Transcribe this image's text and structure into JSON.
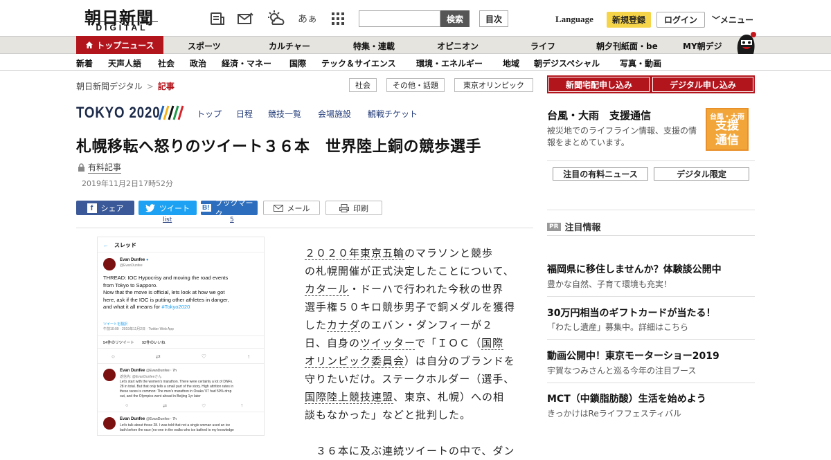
{
  "header": {
    "logo_main": "朝日新聞",
    "logo_sub": "DIGITAL",
    "font_icon_label": "あぁ",
    "search_placeholder": "",
    "search_button": "検索",
    "index_button": "目次",
    "language": "Language",
    "register": "新規登録",
    "login": "ログイン",
    "menu": "メニュー"
  },
  "nav1": {
    "active": "トップニュース",
    "items": [
      "スポーツ",
      "カルチャー",
      "特集・連載",
      "オピニオン",
      "ライフ",
      "朝夕刊紙面・be",
      "MY朝デジ"
    ]
  },
  "nav2": {
    "items": [
      "新着",
      "天声人語",
      "社会",
      "政治",
      "経済・マネー",
      "国際",
      "テック＆サイエンス",
      "環境・エネルギー",
      "地域",
      "朝デジスペシャル",
      "写真・動画"
    ]
  },
  "breadcrumb": {
    "home": "朝日新聞デジタル",
    "sep": ">",
    "current": "記事"
  },
  "tags": [
    "社会",
    "その他・話題",
    "東京オリンピック"
  ],
  "tokyo": {
    "logo": "TOKYO 2020",
    "nav": [
      "トップ",
      "日程",
      "競技一覧",
      "会場施設",
      "観戦チケット"
    ]
  },
  "article": {
    "headline": "札幌移転へ怒りのツイート３６本　世界陸上銅の競歩選手",
    "paid_label": "有料記事",
    "date": "2019年11月2日17時52分",
    "body_lines": [
      [
        {
          "t": "２０２０年東京五輪",
          "l": true
        },
        {
          "t": "のマラソンと競歩",
          "l": false
        }
      ],
      [
        {
          "t": "の札幌開催が正式決定したことについて、",
          "l": false
        }
      ],
      [
        {
          "t": "カタール",
          "l": true
        },
        {
          "t": "・ドーハで行われた今秋の世界",
          "l": false
        }
      ],
      [
        {
          "t": "選手権５０キロ競歩男子で銅メダルを獲得",
          "l": false
        }
      ],
      [
        {
          "t": "した",
          "l": false
        },
        {
          "t": "カナダ",
          "l": true
        },
        {
          "t": "のエバン・ダンフィーが２",
          "l": false
        }
      ],
      [
        {
          "t": "日、自身の",
          "l": false
        },
        {
          "t": "ツイッター",
          "l": true
        },
        {
          "t": "で「ＩＯＣ（",
          "l": false
        },
        {
          "t": "国際",
          "l": true
        }
      ],
      [
        {
          "t": "オリンピック委員会",
          "l": true
        },
        {
          "t": "）は自分のブランドを",
          "l": false
        }
      ],
      [
        {
          "t": "守りたいだけ。ステークホルダー（選手、",
          "l": false
        }
      ],
      [
        {
          "t": "国際陸上競技連盟",
          "l": true
        },
        {
          "t": "、東京、札幌）への相",
          "l": false
        }
      ],
      [
        {
          "t": "談もなかった」などと批判した。",
          "l": false
        }
      ],
      [
        {
          "t": "",
          "l": false
        }
      ],
      [
        {
          "t": "　３６本に及ぶ連続ツイートの中で、ダン",
          "l": false
        }
      ]
    ]
  },
  "share": {
    "facebook": "シェア",
    "twitter": "ツイート",
    "twitter_count": "list",
    "hatena": "ブックマーク",
    "hatena_count": "5",
    "mail": "メール",
    "print": "印刷"
  },
  "tweet": {
    "header": "スレッド",
    "name": "Evan Dunfee",
    "handle": "@EvanDunfee",
    "body": [
      "THREAD: IOC Hypocrisy and moving the road events",
      "from Tokyo to Sapporo.",
      "Now that the move is official, lets look at how we got",
      "here, ask if the IOC is putting other athletes in danger,",
      "and what it all means for "
    ],
    "hashtag": "#Tokyo2020",
    "translate": "ツイートを翻訳",
    "meta": "午前10:09 · 2019年11月2日 · Twitter Web App",
    "retweets": "54件のリツイート",
    "likes": "92件のいいね",
    "reply1_name": "Evan Dunfee",
    "reply1_handle": "@EvanDunfee · 7h",
    "reply1_to": "返信先: @EvanDunfeeさん",
    "reply1_body": [
      "Let's start with the women's marathon. There were certainly a lot of DNFs.",
      "28 in total. But that only tells a small part of the story. High attrition rates in",
      "these races is common: The men's marathon in Osaka '07 had 50% drop",
      "out, and the Olympics went ahead in Beijing 1yr later"
    ],
    "reply2_name": "Evan Dunfee",
    "reply2_handle": "@EvanDunfee · 7h",
    "reply2_body": [
      "Let's talk about those 28. I was told that not a single woman used an ice",
      "bath before the race (no-one in the walks who ice bathed to my knowledge"
    ]
  },
  "sidebar": {
    "btn1": "新聞宅配申し込み",
    "btn2": "デジタル申し込み",
    "typhoon_title": "台風・大雨　支援通信",
    "typhoon_desc": "被災地でのライフライン情報、支援の情報をまとめています。",
    "badge_top": "台風・大雨",
    "badge_main": "支援通信",
    "tab1": "注目の有料ニュース",
    "tab2": "デジタル限定",
    "pr_badge": "PR",
    "pr_head": "注目情報",
    "pr_items": [
      {
        "title": "福岡県に移住しませんか？体験談公開中",
        "desc": "豊かな自然、子育て環境も充実！"
      },
      {
        "title": "30万円相当のギフトカードが当たる！",
        "desc": "「わたし遺産」募集中。詳細はこちら"
      },
      {
        "title": "動画公開中！東京モーターショー2019",
        "desc": "宇賀なつみさんと巡る今年の注目ブース"
      },
      {
        "title": "MCT（中鎖脂肪酸）生活を始めよう",
        "desc": "きっかけはReライフフェスティバル"
      }
    ]
  },
  "colors": {
    "brand_red": "#b3151d",
    "register_yellow": "#f6d44a",
    "facebook": "#3b5998",
    "twitter": "#1da1f2",
    "hatena": "#2c6ebd"
  },
  "icons": [
    "newspaper-icon",
    "mail-icon",
    "weather-icon",
    "font-size-icon",
    "grid-menu-icon",
    "home-icon",
    "lock-icon",
    "facebook-icon",
    "twitter-icon",
    "hatena-icon",
    "mail-share-icon",
    "print-icon",
    "mascot-icon"
  ]
}
